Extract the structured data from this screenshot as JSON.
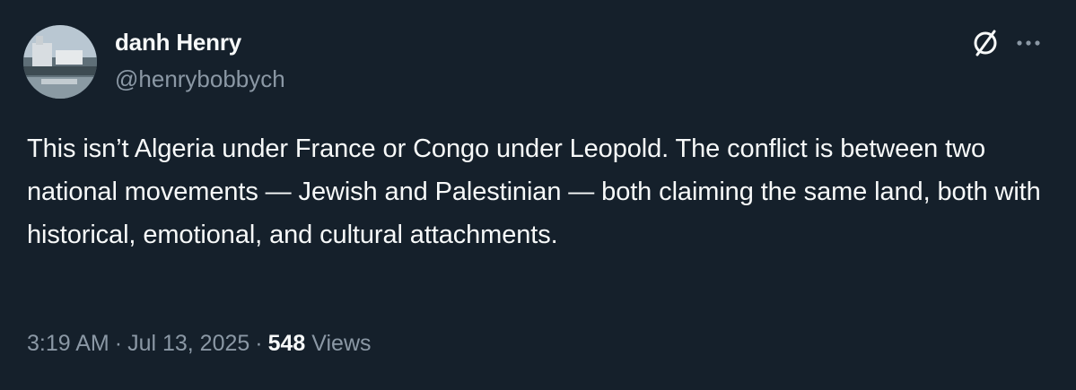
{
  "author": {
    "display_name": "danh Henry",
    "handle": "@henrybobbych"
  },
  "tweet": {
    "text": "This isn’t Algeria under France or Congo under Leopold. The conflict is between two national movements — Jewish and Palestinian — both claiming the same land, both with historical, emotional, and cultural attachments."
  },
  "meta": {
    "time": "3:19 AM",
    "separator": "·",
    "date": "Jul 13, 2025",
    "views_count": "548",
    "views_label": "Views"
  },
  "icons": {
    "grok": "grok-icon",
    "more": "more-icon"
  },
  "colors": {
    "background": "#15202b",
    "primary_text": "#f7f9f9",
    "secondary_text": "#8b98a5"
  }
}
